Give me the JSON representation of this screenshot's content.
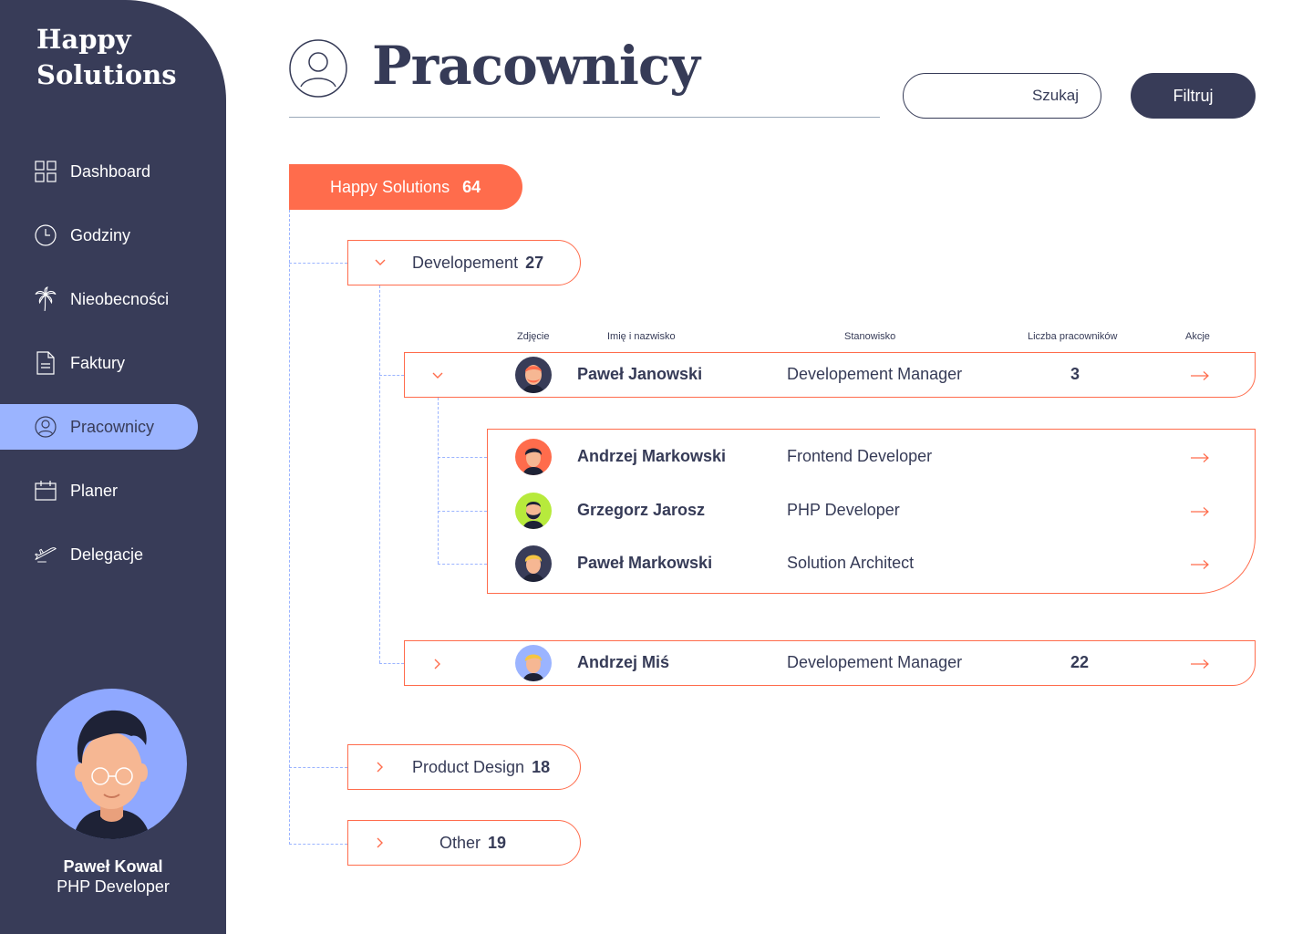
{
  "brand": {
    "line1": "Happy",
    "line2": "Solutions"
  },
  "nav": [
    {
      "label": "Dashboard",
      "icon": "grid-icon"
    },
    {
      "label": "Godziny",
      "icon": "clock-icon"
    },
    {
      "label": "Nieobecności",
      "icon": "palm-tree-icon"
    },
    {
      "label": "Faktury",
      "icon": "document-icon"
    },
    {
      "label": "Pracownicy",
      "icon": "user-circle-icon",
      "active": true
    },
    {
      "label": "Planer",
      "icon": "calendar-icon"
    },
    {
      "label": "Delegacje",
      "icon": "airplane-icon"
    }
  ],
  "profile": {
    "name": "Paweł Kowal",
    "role": "PHP Developer"
  },
  "header": {
    "title": "Pracownicy",
    "search_placeholder": "Szukaj",
    "filter_label": "Filtruj"
  },
  "tree": {
    "company": {
      "name": "Happy Solutions",
      "count": "64"
    },
    "departments": [
      {
        "name": "Developement",
        "count": "27",
        "expanded": true
      },
      {
        "name": "Product Design",
        "count": "18",
        "expanded": false
      },
      {
        "name": "Other",
        "count": "19",
        "expanded": false
      }
    ],
    "columns": {
      "photo": "Zdjęcie",
      "name": "Imię i nazwisko",
      "position": "Stanowisko",
      "count": "Liczba pracowników",
      "actions": "Akcje"
    },
    "managers": [
      {
        "name": "Paweł Janowski",
        "position": "Developement Manager",
        "count": "3",
        "expanded": true,
        "reports": [
          {
            "name": "Andrzej Markowski",
            "position": "Frontend Developer"
          },
          {
            "name": "Grzegorz Jarosz",
            "position": "PHP Developer"
          },
          {
            "name": "Paweł Markowski",
            "position": "Solution Architect"
          }
        ]
      },
      {
        "name": "Andrzej Miś",
        "position": "Developement Manager",
        "count": "22",
        "expanded": false
      }
    ]
  },
  "colors": {
    "sidebar": "#383c58",
    "accent": "#ff6c4c",
    "active": "#9bb4ff",
    "text": "#363b57"
  }
}
